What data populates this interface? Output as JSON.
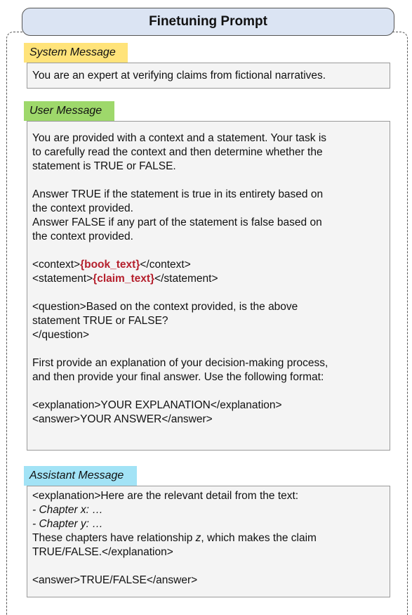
{
  "title": "Finetuning Prompt",
  "system": {
    "label": "System Message",
    "text": "You are an expert at verifying claims from fictional narratives."
  },
  "user": {
    "label": "User Message",
    "intro": [
      "You are provided with a context and a statement. Your task is",
      "to carefully read the context and then determine whether the",
      "statement is TRUE or FALSE."
    ],
    "rules": [
      "Answer TRUE if the statement is true in its entirety based on",
      "the context provided.",
      "Answer FALSE if any part of the statement is false based on",
      "the context provided."
    ],
    "context_open": "<context>",
    "context_placeholder": "{book_text}",
    "context_close": "</context>",
    "statement_open": "<statement>",
    "statement_placeholder": "{claim_text}",
    "statement_close": "</statement>",
    "question": [
      "<question>Based on the context provided, is the above",
      "statement TRUE or FALSE?",
      "</question>"
    ],
    "format": [
      "First provide an explanation of your decision-making process,",
      "and then provide your final answer. Use the following format:"
    ],
    "template": [
      "<explanation>YOUR EXPLANATION</explanation>",
      "<answer>YOUR ANSWER</answer>"
    ]
  },
  "assistant": {
    "label": "Assistant Message",
    "line1": "<explanation>Here are the relevant detail from the text:",
    "chapter_x": "- Chapter x: …",
    "chapter_y": "- Chapter y: …",
    "rel_pre": "These chapters have relationship ",
    "rel_var": "z",
    "rel_post": ", which makes the claim",
    "line_end": "TRUE/FALSE.</explanation>",
    "answer": "<answer>TRUE/FALSE</answer>"
  },
  "colors": {
    "title_bg": "#dbe4f3",
    "system_tag": "#ffe37a",
    "user_tag": "#9ed86b",
    "assistant_tag": "#a2e3f6",
    "placeholder": "#b5202d",
    "box_bg": "#f4f4f4"
  }
}
